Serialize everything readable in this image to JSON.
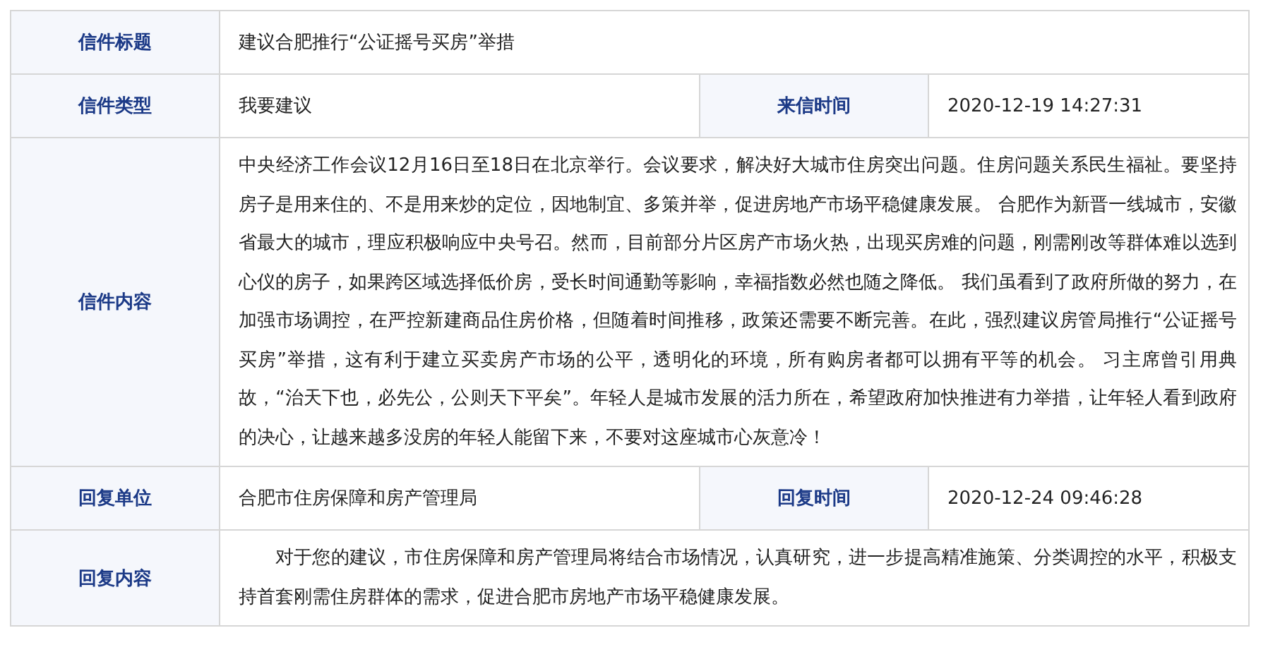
{
  "rows": [
    {
      "label": "信件标题",
      "value": "建议合肥推行“公证摇号买房”举措"
    },
    {
      "label": "信件类型",
      "value": "我要建议",
      "label_2": "来信时间",
      "value_2": "2020-12-19 14:27:31"
    },
    {
      "label": "信件内容",
      "value": "中央经济工作会议12月16日至18日在北京举行。会议要求，解决好大城市住房突出问题。住房问题关系民生福祉。要坚持房子是用来住的、不是用来炒的定位，因地制宜、多策并举，促进房地产市场平稳健康发展。 合肥作为新晋一线城市，安徽省最大的城市，理应积极响应中央号召。然而，目前部分片区房产市场火热，出现买房难的问题，刚需刚改等群体难以选到心仪的房子，如果跨区域选择低价房，受长时间通勤等影响，幸福指数必然也随之降低。 我们虽看到了政府所做的努力，在加强市场调控，在严控新建商品住房价格，但随着时间推移，政策还需要不断完善。在此，强烈建议房管局推行“公证摇号买房”举措，这有利于建立买卖房产市场的公平，透明化的环境，所有购房者都可以拥有平等的机会。 习主席曾引用典故，“治天下也，必先公，公则天下平矣”。年轻人是城市发展的活力所在，希望政府加快推进有力举措，让年轻人看到政府的决心，让越来越多没房的年轻人能留下来，不要对这座城市心灰意冷！"
    },
    {
      "label": "回复单位",
      "value": "合肥市住房保障和房产管理局",
      "label_2": "回复时间",
      "value_2": "2020-12-24 09:46:28"
    },
    {
      "label": "回复内容",
      "value": "对于您的建议，市住房保障和房产管理局将结合市场情况，认真研究，进一步提高精准施策、分类调控的水平，积极支持首套刚需住房群体的需求，促进合肥市房地产市场平稳健康发展。",
      "indented": true
    }
  ]
}
